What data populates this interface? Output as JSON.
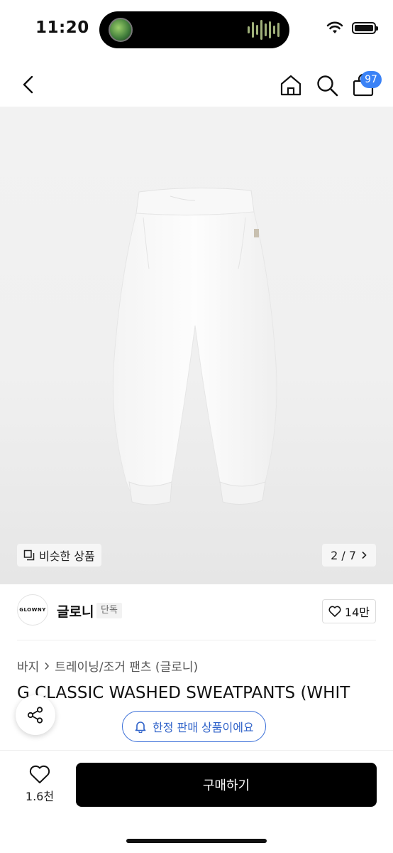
{
  "status_bar": {
    "time": "11:20"
  },
  "nav": {
    "cart_badge": "97"
  },
  "product_image": {
    "similar_label": "비슷한 상품",
    "page_indicator": "2 / 7"
  },
  "brand": {
    "logo_text": "GLOWNY",
    "name": "글로니",
    "tag": "단독",
    "like_count": "14만"
  },
  "breadcrumb": {
    "category": "바지",
    "subcategory": "트레이닝/조거 팬츠 (글로니)"
  },
  "product": {
    "title": "G CLASSIC WASHED SWEATPANTS (WHIT"
  },
  "floating": {
    "limited_notice": "한정 판매 상품이에요"
  },
  "bottom_bar": {
    "wish_count": "1.6천",
    "buy_label": "구매하기"
  },
  "colors": {
    "accent_blue": "#3a82f6",
    "notice_blue": "#2f62c9",
    "buy_button": "#000000"
  }
}
